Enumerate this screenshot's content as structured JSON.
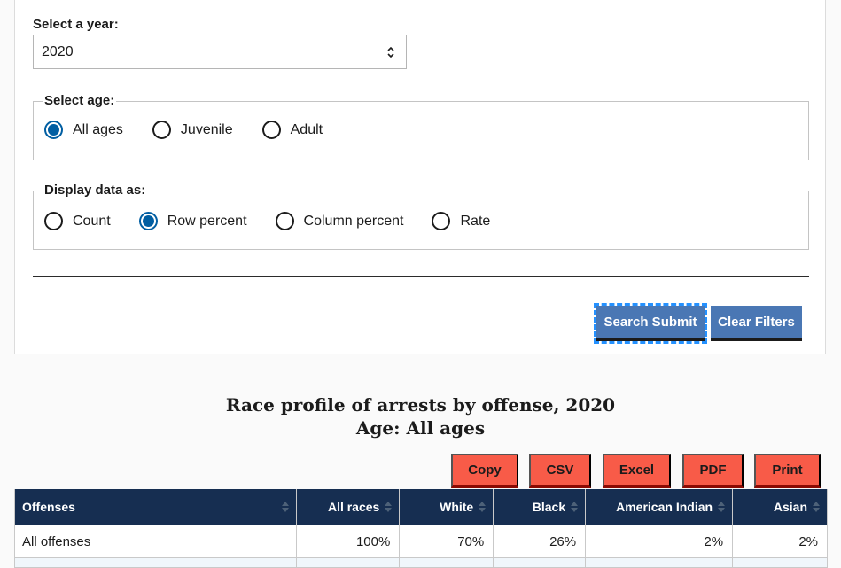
{
  "filters": {
    "year_label": "Select a year:",
    "year_value": "2020",
    "age_legend": "Select age:",
    "age_options": [
      {
        "label": "All ages",
        "checked": true
      },
      {
        "label": "Juvenile",
        "checked": false
      },
      {
        "label": "Adult",
        "checked": false
      }
    ],
    "display_legend": "Display data as:",
    "display_options": [
      {
        "label": "Count",
        "checked": false
      },
      {
        "label": "Row percent",
        "checked": true
      },
      {
        "label": "Column percent",
        "checked": false
      },
      {
        "label": "Rate",
        "checked": false
      }
    ],
    "search_button": "Search Submit",
    "clear_button": "Clear Filters"
  },
  "report": {
    "title": "Race profile of arrests by offense, 2020",
    "subtitle": "Age: All ages"
  },
  "export_buttons": [
    "Copy",
    "CSV",
    "Excel",
    "PDF",
    "Print"
  ],
  "table": {
    "columns": [
      "Offenses",
      "All races",
      "White",
      "Black",
      "American Indian",
      "Asian"
    ],
    "rows": [
      [
        "All offenses",
        "100%",
        "70%",
        "26%",
        "2%",
        "2%"
      ]
    ]
  },
  "colors": {
    "primary_blue": "#4a77b4",
    "radio_checked": "#005ea2",
    "table_header": "#162e51",
    "export_button": "#f85b48",
    "focus_outline": "#2491ff"
  }
}
